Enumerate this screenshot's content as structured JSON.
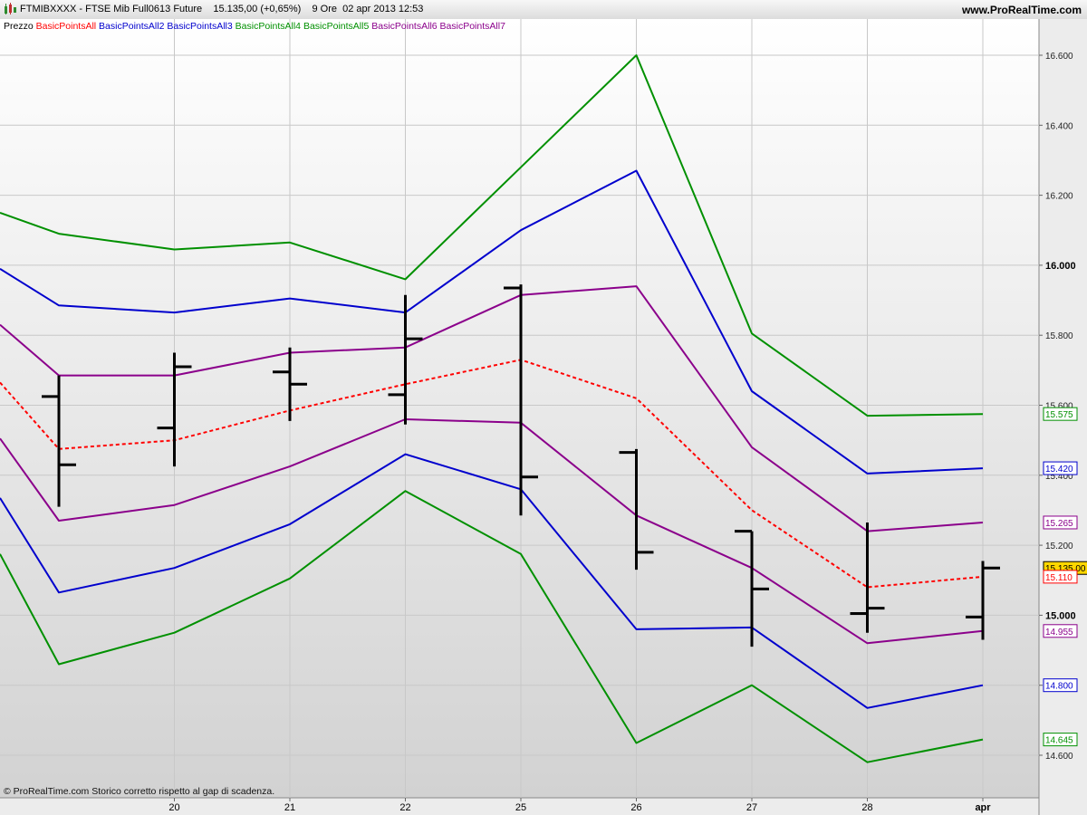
{
  "header": {
    "title": "FTMIBXXXX - FTSE Mib Full0613 Future    15.135,00 (+0,65%)    9 Ore  02 apr 2013 12:53",
    "site": "www.ProRealTime.com"
  },
  "footer": {
    "note": "© ProRealTime.com  Storico corretto rispetto al gap di scadenza."
  },
  "colors": {
    "price": "#000000",
    "pivot": "#ff0000",
    "r1s1": "#8b008b",
    "r2s2": "#0000cd",
    "r3s3": "#009000",
    "background_top": "#ffffff",
    "background_bottom": "#d2d2d2",
    "gridline": "#c8c8c8"
  },
  "chart_data": {
    "type": "line",
    "title": "",
    "y_range": [
      14.48,
      16.76
    ],
    "y_ticks": [
      {
        "value": 14.6,
        "label": "14.600",
        "bold": false
      },
      {
        "value": 14.8,
        "label": "14.800",
        "bold": false
      },
      {
        "value": 15.0,
        "label": "15.000",
        "bold": true
      },
      {
        "value": 15.2,
        "label": "15.200",
        "bold": false
      },
      {
        "value": 15.4,
        "label": "15.400",
        "bold": false
      },
      {
        "value": 15.6,
        "label": "15.600",
        "bold": false
      },
      {
        "value": 15.8,
        "label": "15.800",
        "bold": false
      },
      {
        "value": 16.0,
        "label": "16.000",
        "bold": true
      },
      {
        "value": 16.2,
        "label": "16.200",
        "bold": false
      },
      {
        "value": 16.4,
        "label": "16.400",
        "bold": false
      },
      {
        "value": 16.6,
        "label": "16.600",
        "bold": false
      }
    ],
    "x_labels": [
      "",
      "20",
      "21",
      "22",
      "25",
      "26",
      "27",
      "28",
      "apr"
    ],
    "legend": [
      {
        "name": "Prezzo",
        "color": "#000000"
      },
      {
        "name": "BasicPointsAll",
        "color": "#ff0000"
      },
      {
        "name": "BasicPointsAll2",
        "color": "#0000cd"
      },
      {
        "name": "BasicPointsAll3",
        "color": "#0000cd"
      },
      {
        "name": "BasicPointsAll4",
        "color": "#009000"
      },
      {
        "name": "BasicPointsAll5",
        "color": "#009000"
      },
      {
        "name": "BasicPointsAll6",
        "color": "#8b008b"
      },
      {
        "name": "BasicPointsAll7",
        "color": "#8b008b"
      }
    ],
    "price_bars": [
      {
        "open": 15.625,
        "high": 15.685,
        "low": 15.31,
        "close": 15.43
      },
      {
        "open": 15.535,
        "high": 15.75,
        "low": 15.425,
        "close": 15.71
      },
      {
        "open": 15.695,
        "high": 15.765,
        "low": 15.555,
        "close": 15.66
      },
      {
        "open": 15.63,
        "high": 15.915,
        "low": 15.545,
        "close": 15.79
      },
      {
        "open": 15.935,
        "high": 15.945,
        "low": 15.285,
        "close": 15.395
      },
      {
        "open": 15.465,
        "high": 15.475,
        "low": 15.13,
        "close": 15.18
      },
      {
        "open": 15.24,
        "high": 15.24,
        "low": 14.91,
        "close": 15.075
      },
      {
        "open": 15.005,
        "high": 15.265,
        "low": 14.95,
        "close": 15.02
      },
      {
        "open": 14.995,
        "high": 15.155,
        "low": 14.93,
        "close": 15.135
      }
    ],
    "series": [
      {
        "name": "BasicPointsAll",
        "color": "#ff0000",
        "dashed": true,
        "start": 15.665,
        "values": [
          15.475,
          15.5,
          15.585,
          15.66,
          15.73,
          15.62,
          15.3,
          15.08,
          15.11
        ]
      },
      {
        "name": "BasicPointsAll2",
        "color": "#0000cd",
        "start": 15.99,
        "values": [
          15.885,
          15.865,
          15.905,
          15.865,
          16.1,
          16.27,
          15.64,
          15.405,
          15.42
        ]
      },
      {
        "name": "BasicPointsAll3",
        "color": "#0000cd",
        "start": 15.335,
        "values": [
          15.065,
          15.135,
          15.26,
          15.46,
          15.36,
          14.96,
          14.965,
          14.735,
          14.8
        ]
      },
      {
        "name": "BasicPointsAll4",
        "color": "#009000",
        "start": 16.15,
        "values": [
          16.09,
          16.045,
          16.065,
          15.96,
          16.28,
          16.6,
          15.805,
          15.57,
          15.575
        ]
      },
      {
        "name": "BasicPointsAll5",
        "color": "#009000",
        "start": 15.175,
        "values": [
          14.86,
          14.95,
          15.105,
          15.355,
          15.175,
          14.635,
          14.8,
          14.58,
          14.645
        ]
      },
      {
        "name": "BasicPointsAll6",
        "color": "#8b008b",
        "start": 15.83,
        "values": [
          15.685,
          15.685,
          15.75,
          15.765,
          15.915,
          15.94,
          15.48,
          15.24,
          15.265
        ]
      },
      {
        "name": "BasicPointsAll7",
        "color": "#8b008b",
        "start": 15.505,
        "values": [
          15.27,
          15.315,
          15.425,
          15.56,
          15.55,
          15.285,
          15.135,
          14.92,
          14.955
        ]
      }
    ],
    "last_value_tags": [
      {
        "label": "15.575",
        "value": 15.575,
        "color": "#009000",
        "bg": "#ffffff"
      },
      {
        "label": "15.420",
        "value": 15.42,
        "color": "#0000cd",
        "bg": "#ffffff"
      },
      {
        "label": "15.265",
        "value": 15.265,
        "color": "#8b008b",
        "bg": "#ffffff"
      },
      {
        "label": "15.135,00",
        "value": 15.135,
        "color": "#000000",
        "bg": "#ffd700"
      },
      {
        "label": "15.110",
        "value": 15.11,
        "color": "#ff0000",
        "bg": "#ffffff"
      },
      {
        "label": "14.955",
        "value": 14.955,
        "color": "#8b008b",
        "bg": "#ffffff"
      },
      {
        "label": "14.800",
        "value": 14.8,
        "color": "#0000cd",
        "bg": "#ffffff"
      },
      {
        "label": "14.645",
        "value": 14.645,
        "color": "#009000",
        "bg": "#ffffff"
      }
    ]
  }
}
